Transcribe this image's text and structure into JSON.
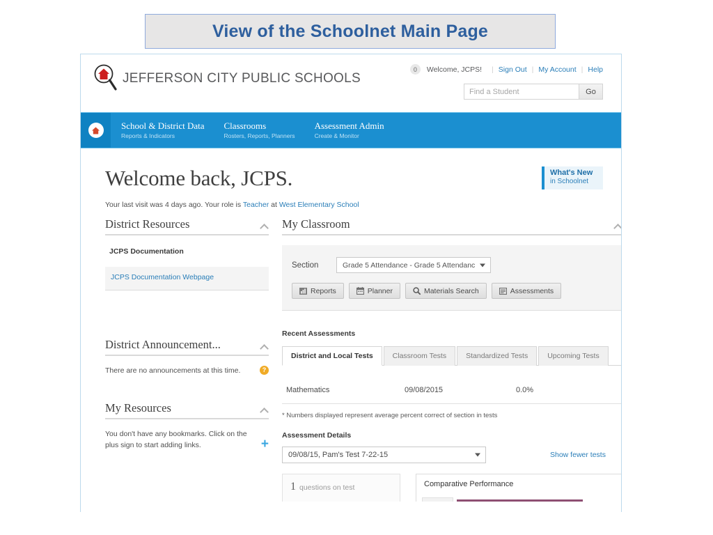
{
  "slide": {
    "title": "View of the Schoolnet Main Page"
  },
  "header": {
    "district_name": "JEFFERSON CITY PUBLIC SCHOOLS",
    "logo_icon": "house-magnifier-logo",
    "notification_count": "0",
    "welcome": "Welcome, JCPS!",
    "links": [
      {
        "label": "Sign Out"
      },
      {
        "label": "My Account"
      },
      {
        "label": "Help"
      }
    ],
    "separator": "|",
    "search": {
      "placeholder": "Find a Student",
      "value": "",
      "button": "Go"
    }
  },
  "nav": {
    "home_icon": "home-icon",
    "items": [
      {
        "title": "School & District Data",
        "subtitle": "Reports & Indicators"
      },
      {
        "title": "Classrooms",
        "subtitle": "Rosters, Reports, Planners"
      },
      {
        "title": "Assessment Admin",
        "subtitle": "Create & Monitor"
      }
    ]
  },
  "welcome_block": {
    "heading": "Welcome back, JCPS.",
    "last_visit_prefix": "Your last visit was 4 days ago. Your role is ",
    "role": "Teacher",
    "at": " at ",
    "school": "West Elementary School",
    "whats_new_line1": "What's New",
    "whats_new_line2": "in Schoolnet"
  },
  "district_resources": {
    "title": "District Resources",
    "sub_head": "JCPS Documentation",
    "link_text": "JCPS Documentation Webpage"
  },
  "district_announcements": {
    "title": "District Announcement...",
    "body": "There are no announcements at this time.",
    "help_glyph": "?"
  },
  "my_resources": {
    "title": "My Resources",
    "plus_glyph": "+",
    "body": "You don't have any bookmarks. Click on the plus sign to start adding links."
  },
  "my_classroom": {
    "title": "My Classroom",
    "section_label": "Section",
    "section_value": "Grade 5 Attendance - Grade 5 Attendanc",
    "help_glyph": "?",
    "buttons": [
      {
        "label": "Reports",
        "icon": "bar-chart-icon"
      },
      {
        "label": "Planner",
        "icon": "calendar-icon"
      },
      {
        "label": "Materials Search",
        "icon": "search-icon"
      },
      {
        "label": "Assessments",
        "icon": "list-icon"
      }
    ]
  },
  "recent_assessments": {
    "title": "Recent Assessments",
    "tabs": [
      {
        "label": "District and Local Tests",
        "active": true
      },
      {
        "label": "Classroom Tests",
        "active": false
      },
      {
        "label": "Standardized Tests",
        "active": false
      },
      {
        "label": "Upcoming Tests",
        "active": false
      }
    ],
    "rows": [
      {
        "subject": "Mathematics",
        "date": "09/08/2015",
        "percent": "0.0%"
      }
    ],
    "footnote": "* Numbers displayed represent average percent correct of section in tests"
  },
  "assessment_details": {
    "title": "Assessment Details",
    "selected_test": "09/08/15, Pam's Test 7-22-15",
    "show_fewer": "Show fewer tests",
    "questions_count": "1",
    "questions_label": "questions on test",
    "comparative_title": "Comparative Performance"
  },
  "colors": {
    "nav_blue": "#1b8fd0",
    "nav_home_blue": "#0f82c2",
    "link_blue": "#2a7eb8",
    "title_blue": "#2e5f9e",
    "help_orange": "#f0ab26",
    "logo_red": "#cc1f1f",
    "banner_gray": "#e7e6e6"
  }
}
